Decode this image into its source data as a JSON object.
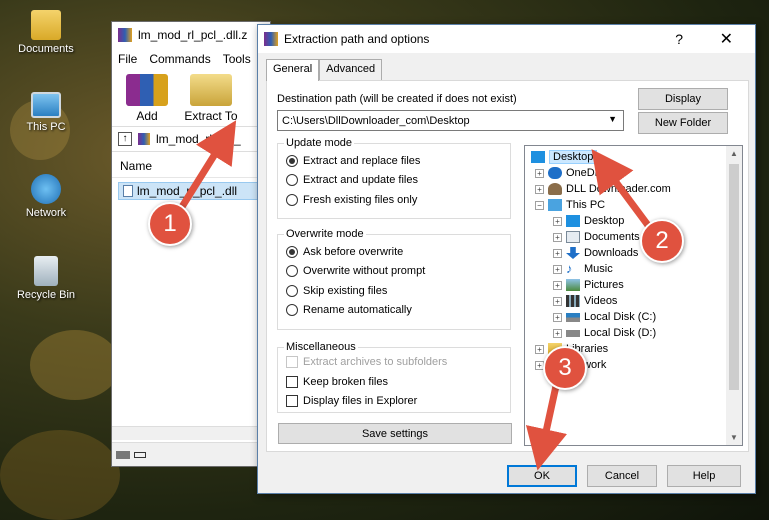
{
  "desktop": {
    "icons": [
      {
        "label": "Documents",
        "icon": "folder-icon"
      },
      {
        "label": "This PC",
        "icon": "computer-icon"
      },
      {
        "label": "Network",
        "icon": "network-icon"
      },
      {
        "label": "Recycle Bin",
        "icon": "recycle-bin-icon"
      }
    ]
  },
  "winrar": {
    "title": "lm_mod_rl_pcl_.dll.z",
    "menu": [
      "File",
      "Commands",
      "Tools"
    ],
    "toolbar": {
      "add": "Add",
      "extract_to": "Extract To"
    },
    "path": "lm_mod_rl_pcl_",
    "list_header": "Name",
    "row": "lm_mod_rl_pcl_.dll"
  },
  "dialog": {
    "title": "Extraction path and options",
    "help": "?",
    "close": "✕",
    "tabs": [
      "General",
      "Advanced"
    ],
    "dest_label": "Destination path (will be created if does not exist)",
    "dest_value": "C:\\Users\\DllDownloader_com\\Desktop",
    "display_btn": "Display",
    "new_folder_btn": "New Folder",
    "update_mode": {
      "title": "Update mode",
      "options": [
        "Extract and replace files",
        "Extract and update files",
        "Fresh existing files only"
      ],
      "selected": 0
    },
    "overwrite_mode": {
      "title": "Overwrite mode",
      "options": [
        "Ask before overwrite",
        "Overwrite without prompt",
        "Skip existing files",
        "Rename automatically"
      ],
      "selected": 0
    },
    "misc": {
      "title": "Miscellaneous",
      "options": [
        "Extract archives to subfolders",
        "Keep broken files",
        "Display files in Explorer"
      ]
    },
    "save_settings": "Save settings",
    "tree": {
      "desktop": "Desktop",
      "onedrive": "OneDrive",
      "dll": "DLL Downloader.com",
      "thispc": "This PC",
      "pc_desktop": "Desktop",
      "documents": "Documents",
      "downloads": "Downloads",
      "music": "Music",
      "pictures": "Pictures",
      "videos": "Videos",
      "disk_c": "Local Disk (C:)",
      "disk_d": "Local Disk (D:)",
      "libraries": "Libraries",
      "network": "Network"
    },
    "ok": "OK",
    "cancel": "Cancel",
    "help_btn": "Help"
  },
  "callouts": [
    "1",
    "2",
    "3"
  ],
  "colors": {
    "callout": "#e0523f",
    "selection": "#cce8ff",
    "ok_border": "#0078d7"
  }
}
